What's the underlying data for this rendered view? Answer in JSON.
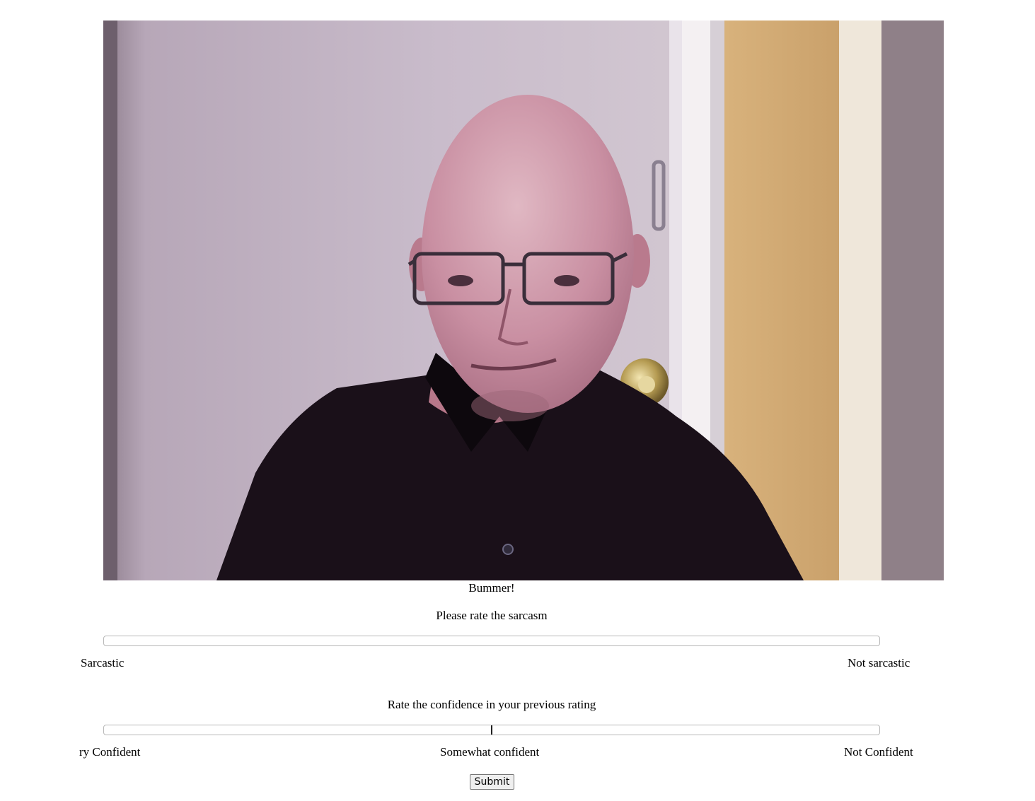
{
  "video": {
    "description_icon": "webcam-video-frame"
  },
  "caption": "Bummer!",
  "sarcasm": {
    "prompt": "Please rate the sarcasm",
    "value": null,
    "left_label": "Sarcastic",
    "right_label": "Not sarcastic"
  },
  "confidence": {
    "prompt": "Rate the confidence in your previous rating",
    "value": 0.5,
    "left_label": "ry Confident",
    "middle_label": "Somewhat confident",
    "right_label": "Not Confident"
  },
  "submit_label": "Submit"
}
